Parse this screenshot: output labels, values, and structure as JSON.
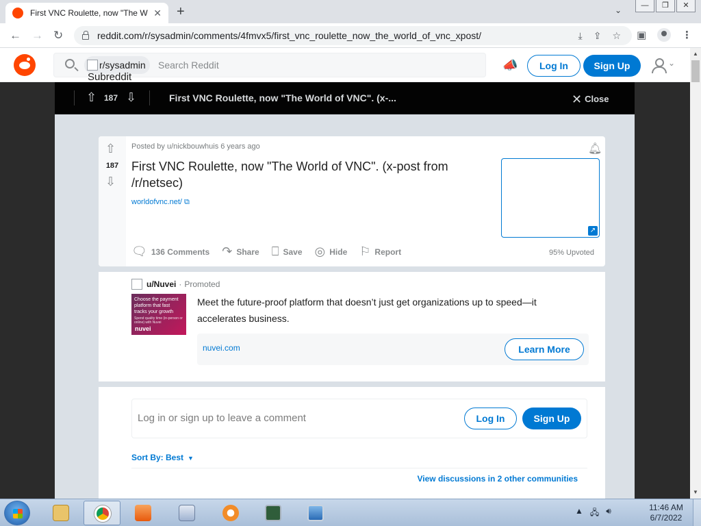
{
  "browser": {
    "tab_title": "First VNC Roulette, now \"The Wo",
    "tab_close": "✕",
    "new_tab": "+",
    "tab_dropdown": "⌄",
    "url": "reddit.com/r/sysadmin/comments/4fmvx5/first_vnc_roulette_now_the_world_of_vnc_xpost/",
    "window_buttons": [
      "—",
      "❐",
      "✕"
    ]
  },
  "header": {
    "subreddit_chip": "r/sysadmin",
    "chip_caption": "Subreddit",
    "search_placeholder": "Search Reddit",
    "login_label": "Log In",
    "signup_label": "Sign Up"
  },
  "modal_bar": {
    "score": "187",
    "title": "First VNC Roulette, now \"The World of VNC\". (x-...",
    "close_label": "Close"
  },
  "post": {
    "posted_by": "Posted by u/nickbouwhuis 6 years ago",
    "score": "187",
    "title": "First VNC Roulette, now \"The World of VNC\". (x-post from /r/netsec)",
    "link_text": "worldofvnc.net/",
    "actions": [
      {
        "label": "136 Comments",
        "icon": "comment-icon"
      },
      {
        "label": "Share",
        "icon": "share-icon"
      },
      {
        "label": "Save",
        "icon": "bookmark-icon"
      },
      {
        "label": "Hide",
        "icon": "eye-slash-icon"
      },
      {
        "label": "Report",
        "icon": "flag-icon"
      }
    ],
    "upvoted": "95% Upvoted"
  },
  "promoted": {
    "user": "u/Nuvei",
    "separator": "·",
    "tag": "Promoted",
    "image_text": "Choose the payment platform that fast tracks your growth",
    "image_subtext": "Spend quality time (in-person or online) with Nuvei",
    "image_logo": "nuvei",
    "text": "Meet the future-proof platform that doesn’t just get organizations up to speed—it accelerates business.",
    "domain": "nuvei.com",
    "cta": "Learn More"
  },
  "comments": {
    "login_prompt": "Log in or sign up to leave a comment",
    "login_label": "Log In",
    "signup_label": "Sign Up",
    "sort_label": "Sort By: Best",
    "other_communities": "View discussions in 2 other communities"
  },
  "taskbar": {
    "time": "11:46 AM",
    "date": "6/7/2022"
  },
  "colors": {
    "reddit_orange": "#ff4500",
    "reddit_blue": "#0079d3",
    "modal_bar": "#030303"
  }
}
